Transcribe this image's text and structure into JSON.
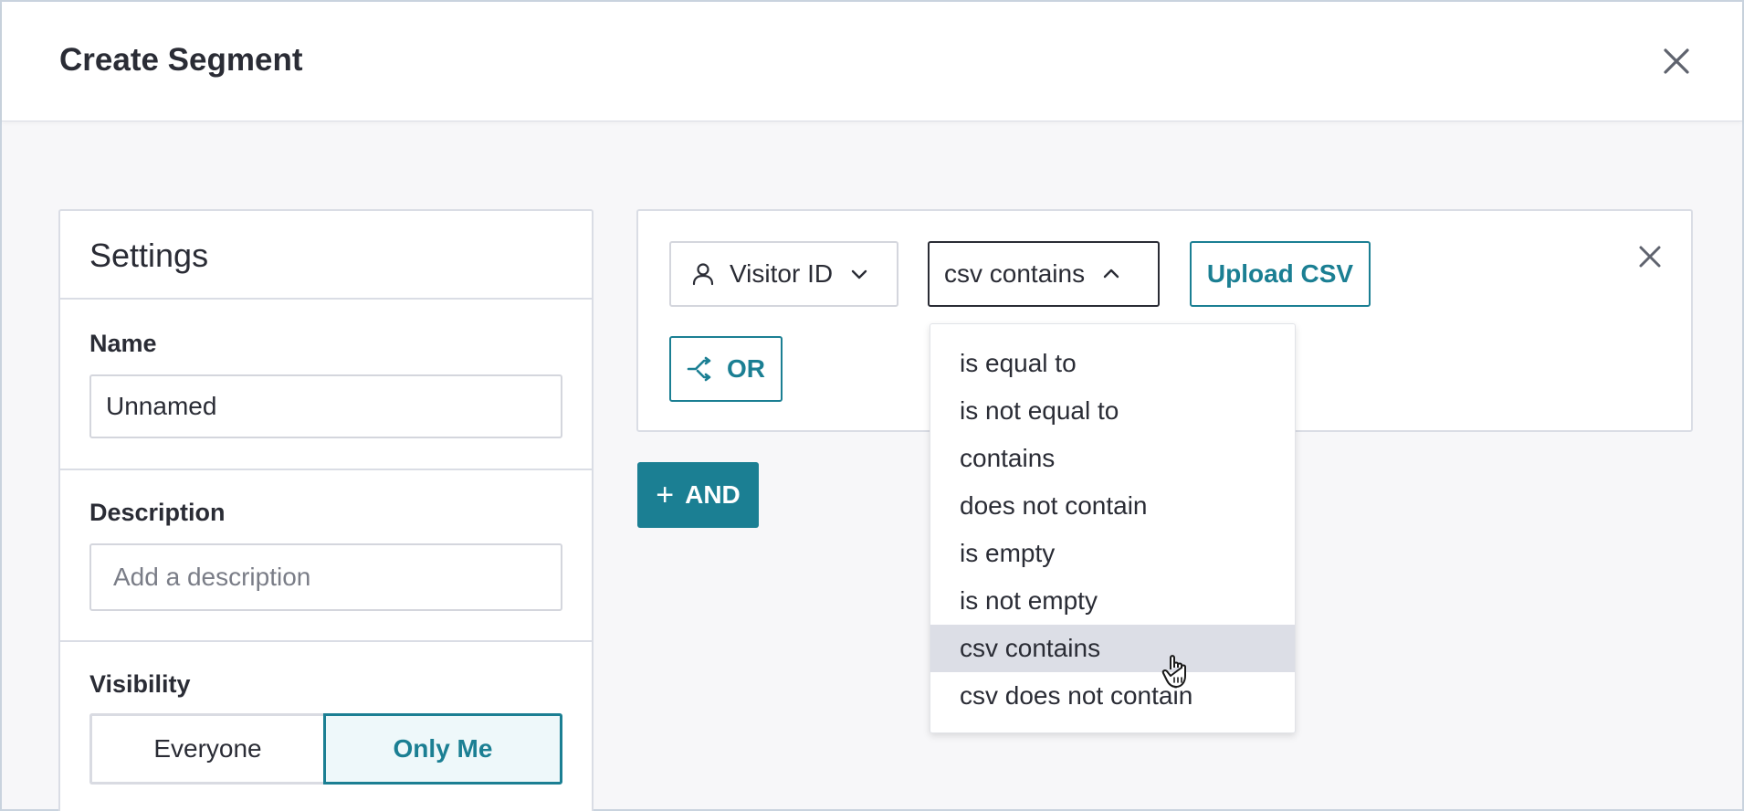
{
  "dialog": {
    "title": "Create Segment"
  },
  "settings": {
    "title": "Settings",
    "name_label": "Name",
    "name_value": "Unnamed",
    "description_label": "Description",
    "description_placeholder": "Add a description",
    "visibility_label": "Visibility",
    "visibility_options": [
      "Everyone",
      "Only Me"
    ],
    "visibility_selected": "Only Me"
  },
  "rule": {
    "attribute": "Visitor ID",
    "attribute_icon": "person-icon",
    "operator": "csv contains",
    "upload_label": "Upload CSV",
    "or_label": "OR",
    "and_label": "AND"
  },
  "operator_menu": {
    "items": [
      "is equal to",
      "is not equal to",
      "contains",
      "does not contain",
      "is empty",
      "is not empty",
      "csv contains",
      "csv does not contain"
    ],
    "highlighted": "csv contains"
  },
  "colors": {
    "accent": "#1b7f93",
    "text": "#2a2c35",
    "border": "#dadde5",
    "background": "#f7f7f9",
    "menu_highlight": "#dcdee6"
  }
}
